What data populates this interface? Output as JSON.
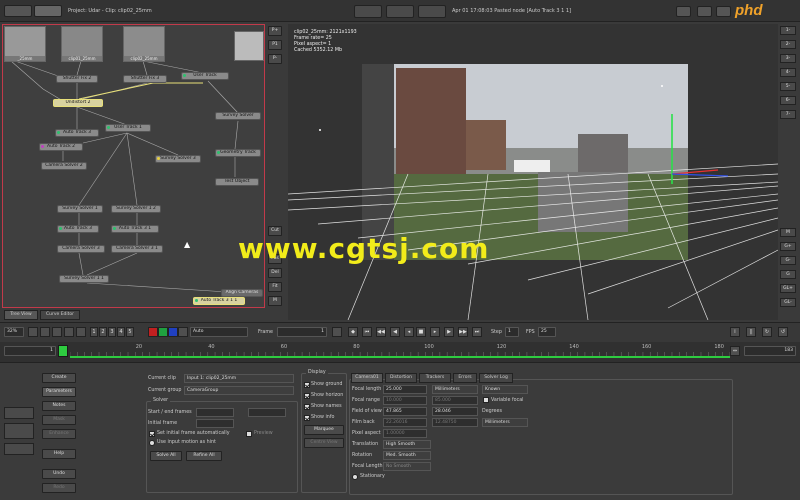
{
  "topbar": {
    "project": "Project: Udar - Clip: clip02_25mm",
    "status": "Apr 01 17:08:03 Pasted node [Auto Track 3 1 1]",
    "logo": "phd"
  },
  "graph": {
    "thumbs": [
      {
        "label": "_25mm"
      },
      {
        "label": "clip01_25mm"
      },
      {
        "label": "clip02_25mm"
      },
      {
        "label": ""
      }
    ],
    "nodes": [
      {
        "label": "Shutter Fix 2",
        "sel": false
      },
      {
        "label": "Shutter Fix 3",
        "sel": false
      },
      {
        "label": "User Track",
        "sel": false
      },
      {
        "label": "Undistort 2",
        "sel": true
      },
      {
        "label": "Auto Track 3",
        "sel": false
      },
      {
        "label": "User Track 1",
        "sel": false
      },
      {
        "label": "Survey Solver",
        "sel": false
      },
      {
        "label": "Auto Track 2",
        "sel": false
      },
      {
        "label": "Survey Solver 3",
        "sel": false
      },
      {
        "label": "Geometry Track",
        "sel": false
      },
      {
        "label": "Camera Solver 2",
        "sel": false
      },
      {
        "label": "Test Object",
        "sel": false
      },
      {
        "label": "Survey Solver 1",
        "sel": false
      },
      {
        "label": "Survey Solver 1 2",
        "sel": false
      },
      {
        "label": "Auto Track 3",
        "sel": false
      },
      {
        "label": "Auto Track 3 1",
        "sel": false
      },
      {
        "label": "Camera Solver 3",
        "sel": false
      },
      {
        "label": "Camera Solver 3 1",
        "sel": false
      },
      {
        "label": "Survey Solver 1 1",
        "sel": false
      },
      {
        "label": "Align Cameras",
        "sel": false
      },
      {
        "label": "Auto Track 3 1 1",
        "sel": true
      }
    ],
    "side_buttons": [
      "P+",
      "P1",
      "P-",
      "Cut",
      "Pas",
      "Del",
      "Fit",
      "M"
    ]
  },
  "tabs": {
    "tree": "Tree View",
    "curve": "Curve Editor"
  },
  "viewer": {
    "info": [
      "clip02_25mm: 2121x1193",
      "Frame rate= 25",
      "Pixel aspect= 1",
      "Cached 5352.12 Mb"
    ],
    "right_buttons_top": [
      "1-",
      "2-",
      "3-",
      "4-",
      "5-",
      "6-",
      "7-"
    ],
    "right_buttons_bottom": [
      "M",
      "G+",
      "G-",
      "G",
      "GL+",
      "GL-"
    ]
  },
  "watermark": "www.cgtsj.com",
  "controls": {
    "zoom": "32%",
    "numbers": [
      "1",
      "2",
      "3",
      "4",
      "5"
    ],
    "pip_select": "Auto",
    "frame_label": "Frame",
    "frame_value": "1",
    "step_label": "Step",
    "step_value": "1",
    "fps_label": "FPS",
    "fps_value": "25"
  },
  "timeline": {
    "start": "1",
    "end": "183",
    "ticks": [
      "20",
      "40",
      "60",
      "80",
      "100",
      "120",
      "140",
      "160",
      "180"
    ],
    "progress": 1.0
  },
  "left_buttons": [
    "Create",
    "Parameters",
    "Notes",
    "Mask",
    "Enhance",
    "Help",
    "Undo",
    "Redo"
  ],
  "solver": {
    "current_clip_label": "Current clip",
    "current_clip": "Input 1: clip02_25mm",
    "current_group_label": "Current group",
    "current_group": "CameraGroup",
    "solver_title": "Solver",
    "start_end_label": "Start / end frames",
    "initial_frame_label": "Initial frame",
    "set_initial_label": "Set initial frame automatically",
    "preview_label": "Preview",
    "use_input_label": "Use input motion as hint",
    "solve_all": "Solve All",
    "refine_all": "Refine All"
  },
  "display": {
    "title": "Display",
    "items": [
      "Show ground",
      "Show horizon",
      "Show names",
      "Show info"
    ],
    "marquee": "Marquee",
    "centre_view": "Centre View"
  },
  "camera": {
    "tabs": [
      "Camera01",
      "Distortion",
      "Trackers",
      "Errors",
      "Solver Log"
    ],
    "rows": [
      {
        "label": "Focal length",
        "v1": "25.000",
        "u": "Millimeters",
        "k": "Known"
      },
      {
        "label": "Focal range",
        "v1": "10.000",
        "v2": "85.000",
        "extra": "Variable focal"
      },
      {
        "label": "Field of view",
        "v1": "47.865",
        "v2": "28.046",
        "u": "Degrees"
      },
      {
        "label": "Film back",
        "v1": "22.26016",
        "v2": "12.48750",
        "u": "Millimeters"
      },
      {
        "label": "Pixel aspect",
        "v1": "1.00000"
      },
      {
        "label": "Translation",
        "s": "High Smooth"
      },
      {
        "label": "Rotation",
        "s": "Med. Smooth"
      },
      {
        "label": "Focal Length",
        "s": "No Smooth"
      }
    ],
    "stationary": "Stationary"
  }
}
